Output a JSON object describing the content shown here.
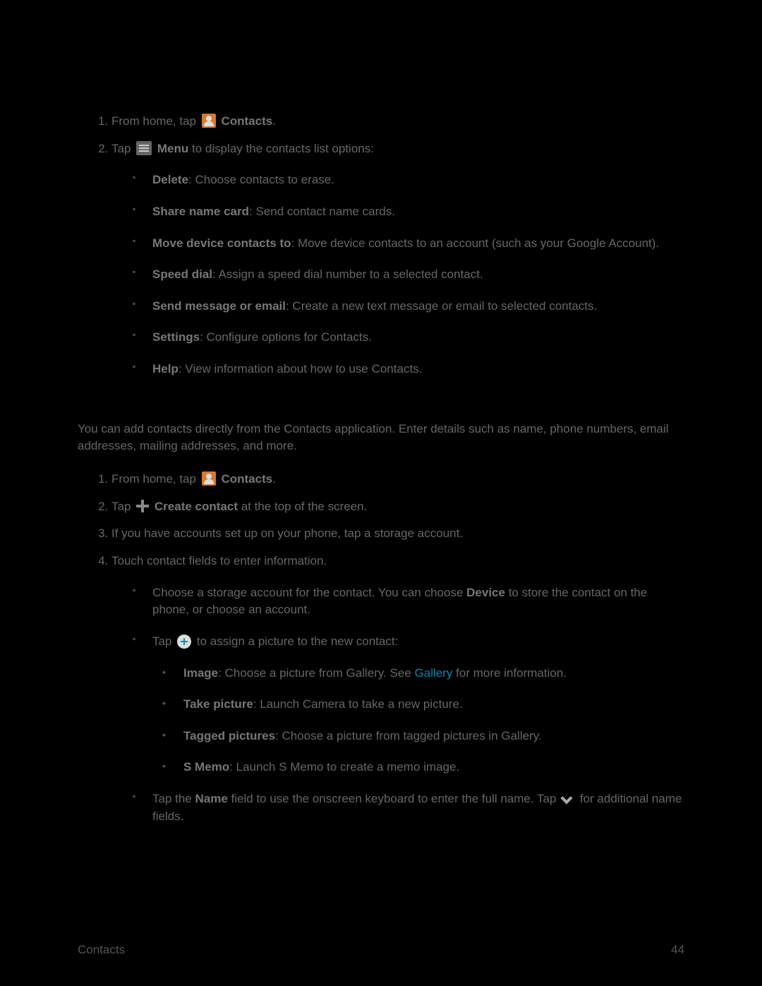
{
  "s1": {
    "li1_a": "From home, tap",
    "li1_b": "Contacts",
    "li1_c": ".",
    "li2_a": "Tap ",
    "li2_b": "Menu",
    "li2_c": " to display the contacts list options:",
    "opts": {
      "delete_b": "Delete",
      "delete_t": ": Choose contacts to erase.",
      "share_b": "Share name card",
      "share_t": ": Send contact name cards.",
      "move_b": "Move device contacts to",
      "move_t": ": Move device contacts to an account (such as your Google Account).",
      "speed_b": "Speed dial",
      "speed_t": ": Assign a speed dial number to a selected contact.",
      "send_b": "Send message or email",
      "send_t": ": Create a new text message or email to selected contacts.",
      "set_b": "Settings",
      "set_t": ": Configure options for Contacts.",
      "help_b": "Help",
      "help_t": ": View information about how to use Contacts."
    }
  },
  "s2": {
    "intro": "You can add contacts directly from the Contacts application. Enter details such as name, phone numbers, email addresses, mailing addresses, and more.",
    "li1_a": "From home, tap",
    "li1_b": "Contacts",
    "li1_c": ".",
    "li2_a": "Tap",
    "li2_b": "Create contact",
    "li2_c": " at the top of the screen.",
    "li3": "If you have accounts set up on your phone, tap a storage account.",
    "li4": "Touch contact fields to enter information.",
    "sub": {
      "storage_a": "Choose a storage account for the contact. You can choose ",
      "storage_b": "Device",
      "storage_c": " to store the contact on the phone, or choose an account.",
      "photo_a": "Tap",
      "photo_b": " to assign a picture to the new contact:",
      "pic": {
        "image_b": "Image",
        "image_t1": ": Choose a picture from Gallery. See ",
        "image_link": "Gallery",
        "image_t2": " for more information.",
        "take_b": "Take picture",
        "take_t": ": Launch Camera to take a new picture.",
        "tag_b": "Tagged pictures",
        "tag_t": ": Choose a picture from tagged pictures in Gallery.",
        "smemo_b": "S Memo",
        "smemo_t": ": Launch S Memo to create a memo image."
      },
      "name_a": "Tap the ",
      "name_b": "Name",
      "name_c": " field to use the onscreen keyboard to enter the full name. Tap ",
      "name_d": " for additional name fields."
    }
  },
  "footer": {
    "left": "Contacts",
    "right": "44"
  }
}
